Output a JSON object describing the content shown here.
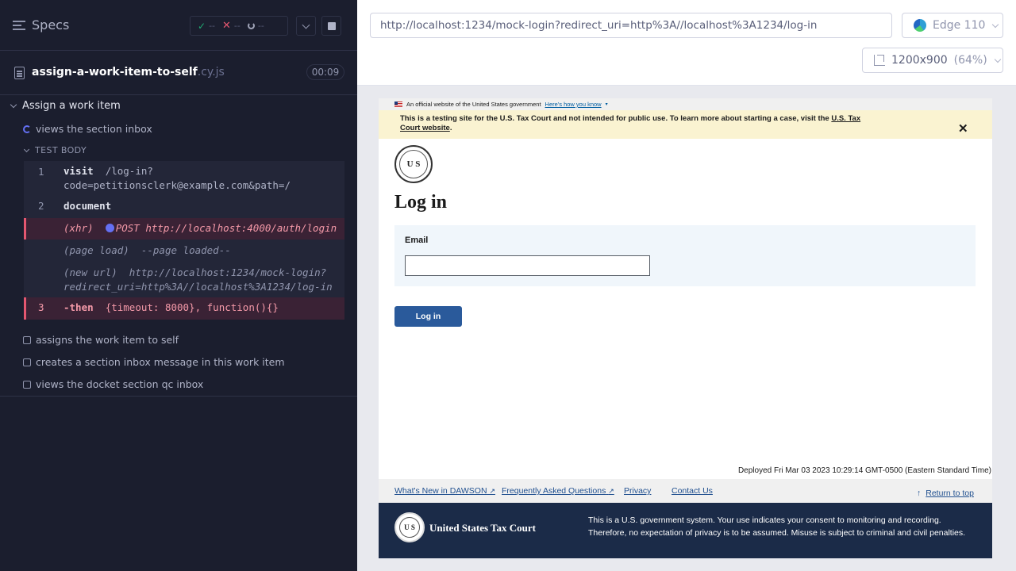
{
  "reporter": {
    "specs_label": "Specs",
    "stats": {
      "passed": "--",
      "failed": "--",
      "pending": "--"
    },
    "spec_file": {
      "name": "assign-a-work-item-to-self",
      "ext": ".cy.js",
      "duration": "00:09"
    },
    "suite": {
      "title": "Assign a work item"
    },
    "tests": [
      {
        "title": "views the section inbox",
        "state": "running"
      },
      {
        "title": "assigns the work item to self",
        "state": "pending"
      },
      {
        "title": "creates a section inbox message in this work item",
        "state": "pending"
      },
      {
        "title": "views the docket section qc inbox",
        "state": "pending"
      }
    ],
    "test_body_label": "TEST BODY",
    "commands": [
      {
        "num": "1",
        "name": "visit",
        "arg_line1": "/log-in?",
        "arg_line2": "code=petitionsclerk@example.com&path=/"
      },
      {
        "num": "2",
        "name": "document"
      },
      {
        "name": "(xhr)",
        "method": "POST",
        "url": "http://localhost:4000/auth/login",
        "state": "failed"
      },
      {
        "name": "(page load)",
        "arg": "--page loaded--"
      },
      {
        "name": "(new url)",
        "arg_line1": "http://localhost:1234/mock-login?",
        "arg_line2": "redirect_uri=http%3A//localhost%3A1234/log-in"
      },
      {
        "num": "3",
        "name": "-then",
        "arg": "{timeout: 8000}, function(){}",
        "state": "failed"
      }
    ]
  },
  "aut": {
    "url": "http://localhost:1234/mock-login?redirect_uri=http%3A//localhost%3A1234/log-in",
    "browser": "Edge 110",
    "viewport": "1200x900",
    "viewport_pct": "(64%)",
    "page": {
      "gov_banner": "An official website of the United States government",
      "gov_banner_link": "Here's how you know",
      "alert_text": "This is a testing site for the U.S. Tax Court and not intended for public use. To learn more about starting a case, visit the",
      "alert_link": "U.S. Tax Court website",
      "alert_end": ".",
      "seal_text": "U S",
      "heading": "Log in",
      "email_label": "Email",
      "email_value": "",
      "login_button": "Log in",
      "deployed": "Deployed Fri Mar 03 2023 10:29:14 GMT-0500 (Eastern Standard Time)",
      "footer_links": [
        "What's New in DAWSON",
        "Frequently Asked Questions",
        "Privacy",
        "Contact Us"
      ],
      "return_to_top": "Return to top",
      "court_name": "United States Tax Court",
      "gov_notice": "This is a U.S. government system. Your use indicates your consent to monitoring and recording. Therefore, no expectation of privacy is to be assumed. Misuse is subject to criminal and civil penalties."
    }
  },
  "colors": {
    "reporter_bg": "#1b1e2e",
    "fail": "#e45770",
    "pass": "#1fa971",
    "running": "#6470f3",
    "login_button": "#2a5a9b",
    "footer_dark": "#1b2b48"
  },
  "icons": [
    "menu-icon",
    "check-icon",
    "x-icon",
    "pending-icon",
    "chevron-down-icon",
    "stop-icon",
    "file-icon",
    "spinner-icon",
    "edge-icon",
    "ruler-icon",
    "flag-icon",
    "close-icon",
    "external-link-icon",
    "arrow-up-icon"
  ]
}
